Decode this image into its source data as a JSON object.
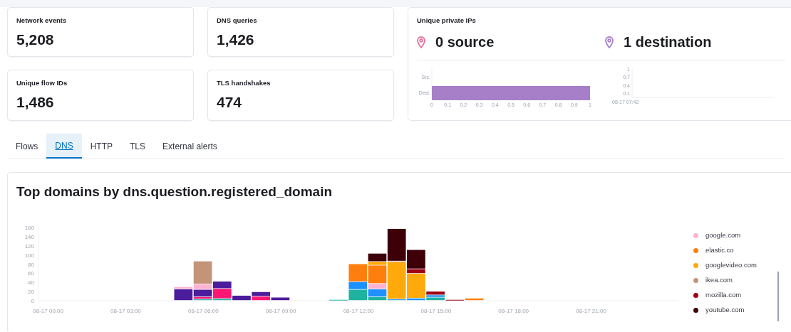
{
  "summary_cards": [
    {
      "label": "Network events",
      "value": "5,208"
    },
    {
      "label": "DNS queries",
      "value": "1,426"
    },
    {
      "label": "Unique flow IDs",
      "value": "1,486"
    },
    {
      "label": "TLS handshakes",
      "value": "474"
    }
  ],
  "private_ips": {
    "title": "Unique private IPs",
    "stats": [
      {
        "text": "0 source",
        "color": "#e8739a"
      },
      {
        "text": "1 destination",
        "color": "#a67fc8"
      }
    ],
    "bar_chart": {
      "chart_data": {
        "type": "bar",
        "orientation": "horizontal",
        "categories": [
          "Src.",
          "Dest."
        ],
        "series": [
          {
            "color": "#a67fc8",
            "values": [
              0,
              1
            ]
          }
        ],
        "xlim": [
          0,
          1
        ],
        "xticks": [
          0,
          0.1,
          0.2,
          0.3,
          0.4,
          0.5,
          0.6,
          0.7,
          0.8,
          0.9,
          1
        ]
      }
    },
    "empty_chart": {
      "axis_labels": [
        "1",
        "0.7",
        "0.4",
        "0.1"
      ],
      "time_label": "08-17 07:42"
    }
  },
  "tabs": [
    {
      "label": "Flows",
      "selected": false
    },
    {
      "label": "DNS",
      "selected": true
    },
    {
      "label": "HTTP",
      "selected": false
    },
    {
      "label": "TLS",
      "selected": false
    },
    {
      "label": "External alerts",
      "selected": false
    }
  ],
  "panel": {
    "title": "Top domains by dns.question.registered_domain",
    "chart_data": {
      "type": "bar",
      "stacked": true,
      "legend": "right",
      "categories": [
        "08-17 00:00",
        null,
        null,
        null,
        "08-17 03:00",
        null,
        null,
        null,
        "08-17 06:00",
        null,
        null,
        null,
        "08-17 09:00",
        null,
        null,
        null,
        "08-17 12:00",
        null,
        null,
        null,
        "08-17 15:00",
        null,
        null,
        null,
        "08-17 18:00",
        null,
        null,
        null,
        "08-17 21:00",
        null,
        null,
        null,
        null
      ],
      "ylim": [
        0,
        160
      ],
      "yticks": [
        0,
        20,
        40,
        60,
        80,
        100,
        120,
        140,
        160
      ],
      "series": [
        {
          "color": "#20b2a0",
          "values": [
            0,
            0,
            0,
            0,
            0,
            0,
            0,
            0,
            3,
            4,
            0,
            0,
            0,
            0,
            0,
            2,
            24,
            8,
            0,
            0,
            7,
            0,
            0,
            0,
            0,
            0,
            0,
            0,
            0,
            0,
            0,
            0,
            0
          ]
        },
        {
          "color": "#1e90ff",
          "values": [
            0,
            0,
            0,
            0,
            0,
            0,
            0,
            0,
            0,
            0,
            0,
            0,
            0,
            0,
            0,
            0,
            17,
            17,
            3,
            5,
            5,
            0,
            0,
            0,
            0,
            0,
            0,
            0,
            0,
            0,
            0,
            0,
            0
          ]
        },
        {
          "color": "#ff1675",
          "values": [
            0,
            0,
            0,
            0,
            0,
            0,
            0,
            0,
            5,
            22,
            0,
            9,
            0,
            0,
            0,
            0,
            0,
            0,
            0,
            0,
            0,
            0,
            0,
            0,
            0,
            0,
            0,
            0,
            0,
            0,
            0,
            0,
            0
          ]
        },
        {
          "color": "#4b1c9c",
          "values": [
            0,
            0,
            0,
            0,
            0,
            0,
            0,
            25,
            16,
            16,
            11,
            10,
            7,
            0,
            0,
            0,
            0,
            0,
            0,
            0,
            0,
            0,
            0,
            0,
            0,
            0,
            0,
            0,
            0,
            0,
            0,
            0,
            0
          ]
        },
        {
          "name": "google.com",
          "color": "#ffb3d1",
          "values": [
            0,
            0,
            0,
            0,
            0,
            0,
            0,
            5,
            12,
            0,
            0,
            0,
            0,
            0,
            0,
            0,
            0,
            12,
            0,
            0,
            0,
            0,
            0,
            0,
            0,
            0,
            0,
            0,
            0,
            0,
            0,
            0,
            0
          ]
        },
        {
          "name": "elastic.co",
          "color": "#ff7f0e",
          "values": [
            0,
            0,
            0,
            0,
            0,
            0,
            0,
            0,
            0,
            0,
            0,
            0,
            0,
            0,
            0,
            0,
            39,
            40,
            0,
            0,
            0,
            0,
            5,
            0,
            0,
            0,
            0,
            0,
            0,
            0,
            0,
            0,
            0
          ]
        },
        {
          "name": "googlevideo.com",
          "color": "#ffa90a",
          "values": [
            0,
            0,
            0,
            0,
            0,
            0,
            0,
            0,
            0,
            0,
            0,
            0,
            0,
            0,
            0,
            0,
            0,
            8,
            81,
            54,
            0,
            0,
            0,
            0,
            0,
            0,
            0,
            0,
            0,
            0,
            0,
            0,
            0
          ]
        },
        {
          "name": "ikea.com",
          "color": "#c49478",
          "values": [
            0,
            0,
            0,
            0,
            0,
            0,
            0,
            0,
            50,
            0,
            0,
            0,
            0,
            0,
            0,
            0,
            0,
            0,
            2,
            0,
            0,
            0,
            0,
            0,
            0,
            0,
            0,
            0,
            0,
            0,
            0,
            0,
            0
          ]
        },
        {
          "name": "mozilla.com",
          "color": "#9b0014",
          "values": [
            0,
            0,
            0,
            0,
            0,
            0,
            0,
            0,
            0,
            0,
            0,
            0,
            0,
            0,
            0,
            0,
            0,
            0,
            0,
            10,
            8,
            2,
            0,
            0,
            0,
            0,
            0,
            0,
            0,
            0,
            0,
            0,
            0
          ]
        },
        {
          "name": "youtube.com",
          "color": "#3d0008",
          "values": [
            0,
            0,
            0,
            0,
            0,
            0,
            0,
            0,
            0,
            0,
            0,
            0,
            0,
            0,
            0,
            0,
            0,
            18,
            71,
            42,
            0,
            0,
            0,
            0,
            0,
            0,
            0,
            0,
            0,
            0,
            0,
            0,
            0
          ]
        }
      ]
    }
  }
}
